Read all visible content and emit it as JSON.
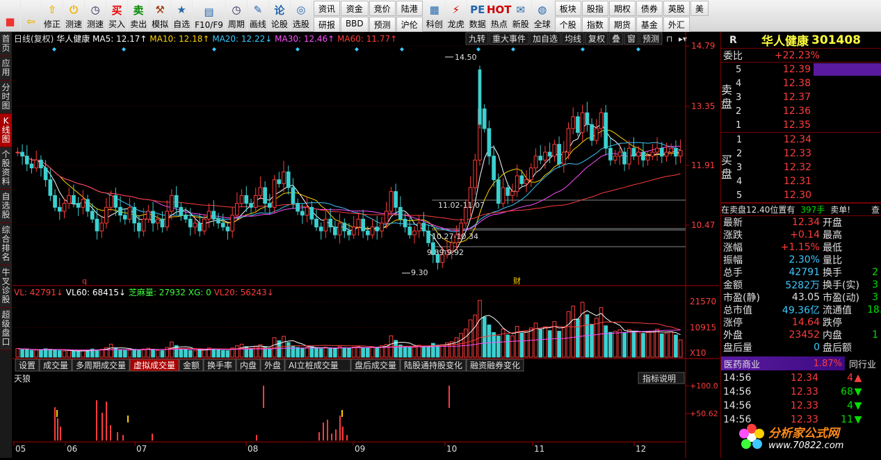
{
  "toolbar": {
    "buttons": [
      {
        "icon": "windows-icon",
        "label": ""
      },
      {
        "icon": "back-arrow-icon",
        "label": ""
      },
      {
        "icon": "up-arrow-icon",
        "label": "修正"
      },
      {
        "icon": "power-icon",
        "label": "测速"
      },
      {
        "icon": "clock-icon",
        "label": "测速"
      },
      {
        "icon": "buy-icon",
        "glyph": "买",
        "label": "买入"
      },
      {
        "icon": "sell-icon",
        "glyph": "卖",
        "label": "卖出"
      },
      {
        "icon": "hammer-icon",
        "label": "模拟"
      },
      {
        "icon": "star-icon",
        "label": "自选"
      },
      {
        "icon": "f10-icon",
        "label": "F10/F9"
      },
      {
        "icon": "clock-icon",
        "label": "周期"
      },
      {
        "icon": "pencil-icon",
        "label": "画线"
      },
      {
        "icon": "lun-icon",
        "glyph": "论",
        "label": "论股"
      },
      {
        "icon": "magnifier-icon",
        "label": "选股"
      }
    ],
    "grid_buttons": [
      "资讯",
      "研报",
      "资金",
      "BBD",
      "竞价",
      "预测",
      "陆港",
      "沪伦"
    ],
    "buttons2": [
      {
        "icon": "chart-icon",
        "label": "科创"
      },
      {
        "icon": "tiger-icon",
        "label": "龙虎"
      },
      {
        "icon": "pe-icon",
        "glyph": "PE",
        "label": "数据"
      },
      {
        "icon": "hot-icon",
        "glyph": "HOT",
        "label": "热点"
      },
      {
        "icon": "new-icon",
        "label": "新股"
      },
      {
        "icon": "globe-icon",
        "label": "全球"
      }
    ],
    "grid_buttons2": [
      "板块",
      "个股",
      "股指",
      "指数",
      "期权",
      "期货",
      "债券",
      "基金",
      "英股",
      "外汇",
      "美"
    ]
  },
  "leftbar": [
    "首页",
    "应用",
    "分时图",
    "K线图",
    "个股资料",
    "自选股",
    "综合排名",
    "牛叉诊股",
    "超级盘口"
  ],
  "header": {
    "title": "日线(复权)",
    "stock": "华人健康",
    "ma": [
      {
        "label": "MA5: 12.17↑",
        "color": "#ffffff"
      },
      {
        "label": "MA10: 12.18↑",
        "color": "#ffd200"
      },
      {
        "label": "MA20: 12.22↓",
        "color": "#3cc8ff"
      },
      {
        "label": "MA30: 12.46↑",
        "color": "#ff4fff"
      },
      {
        "label": "MA60: 11.77↑",
        "color": "#ff3c3c"
      }
    ],
    "buttons": [
      "九转",
      "重大事件",
      "加自选",
      "均线",
      "复权",
      "叠",
      "窗",
      "预测"
    ]
  },
  "price_axis": [
    "14.79",
    "13.35",
    "11.91",
    "10.47"
  ],
  "annotations": [
    "14.50",
    "11.02-11.07",
    "10.27-10.34",
    "9.89-9.92",
    "9.30"
  ],
  "markers": [
    "q",
    "财"
  ],
  "vol_header": {
    "items": [
      {
        "label": "VL: 42791↓",
        "color": "#ff3c3c"
      },
      {
        "label": "VL60: 68415↓",
        "color": "#ffffff"
      },
      {
        "label": "芝麻量: 27932",
        "color": "#3cff3c"
      },
      {
        "label": "XG: 0",
        "color": "#3cff3c"
      },
      {
        "label": "VL20: 56243↓",
        "color": "#ff3c3c"
      }
    ]
  },
  "vol_axis": [
    "21570",
    "10915",
    "X10"
  ],
  "tabs": [
    "设置",
    "成交量",
    "多周期成交量",
    "虚拟成交量",
    "金额",
    "换手率",
    "内盘",
    "外盘",
    "AI立桩成交量",
    "盘后成交量",
    "陆股通持股变化",
    "融资融券变化"
  ],
  "active_tab": "虚拟成交量",
  "ind_name": "天狼",
  "ind_button": "指标说明",
  "ind_axis": [
    "100.0",
    "50.62"
  ],
  "months": [
    "05",
    "06",
    "07",
    "08",
    "09",
    "10",
    "11",
    "12"
  ],
  "right": {
    "code_prefix": "R",
    "name": "华人健康",
    "code": "301408",
    "weibi_label": "委比",
    "weibi": "+22.23%",
    "sell_label": "卖盘",
    "buy_label": "买盘",
    "sell": [
      {
        "n": "5",
        "p": "12.39"
      },
      {
        "n": "4",
        "p": "12.38"
      },
      {
        "n": "3",
        "p": "12.37"
      },
      {
        "n": "2",
        "p": "12.36"
      },
      {
        "n": "1",
        "p": "12.35"
      }
    ],
    "buy": [
      {
        "n": "1",
        "p": "12.34"
      },
      {
        "n": "2",
        "p": "12.33"
      },
      {
        "n": "3",
        "p": "12.32"
      },
      {
        "n": "4",
        "p": "12.31"
      },
      {
        "n": "5",
        "p": "12.30"
      }
    ],
    "notice": "在卖盘12.40位置有",
    "notice_vol": "397手",
    "notice_tag": "卖单!",
    "notice_more": "查",
    "stats": [
      {
        "k": "最新",
        "v": "12.34",
        "vc": "red",
        "k2": "开盘",
        "v2": ""
      },
      {
        "k": "涨跌",
        "v": "+0.14",
        "vc": "red",
        "k2": "最高",
        "v2": ""
      },
      {
        "k": "涨幅",
        "v": "+1.15%",
        "vc": "red",
        "k2": "最低",
        "v2": ""
      },
      {
        "k": "振幅",
        "v": "2.30%",
        "vc": "cyn",
        "k2": "量比",
        "v2": ""
      },
      {
        "k": "总手",
        "v": "42791",
        "vc": "cyn",
        "k2": "换手",
        "v2": "2"
      },
      {
        "k": "金额",
        "v": "5282万",
        "vc": "cyn",
        "k2": "换手(实)",
        "v2": "3"
      },
      {
        "k": "市盈(静)",
        "v": "43.05",
        "vc": "wht",
        "k2": "市盈(动)",
        "v2": "3"
      },
      {
        "k": "总市值",
        "v": "49.36亿",
        "vc": "cyn",
        "k2": "流通值",
        "v2": "18."
      },
      {
        "k": "涨停",
        "v": "14.64",
        "vc": "red",
        "k2": "跌停",
        "v2": ""
      },
      {
        "k": "外盘",
        "v": "23452",
        "vc": "red",
        "k2": "内盘",
        "v2": "1"
      },
      {
        "k": "盘后量",
        "v": "0",
        "vc": "cyn",
        "k2": "盘后额",
        "v2": ""
      }
    ],
    "industry": "医药商业",
    "industry_pct": "1.87%",
    "industry_tab": "同行业",
    "ticks": [
      {
        "t": "14:56",
        "p": "12.34",
        "v": "4",
        "d": "up"
      },
      {
        "t": "14:56",
        "p": "12.33",
        "v": "68",
        "d": "down"
      },
      {
        "t": "14:56",
        "p": "12.33",
        "v": "4",
        "d": "down"
      },
      {
        "t": "14:56",
        "p": "12.33",
        "v": "11",
        "d": "down"
      }
    ],
    "watermark": "分析家公式网",
    "watermark_url": "www.70822.com"
  },
  "chart_data": {
    "type": "candlestick",
    "ylim": [
      9.0,
      15.0
    ],
    "closes": [
      12.3,
      12.2,
      12.0,
      11.9,
      12.1,
      11.9,
      11.6,
      11.2,
      10.9,
      10.8,
      11.0,
      11.2,
      11.0,
      10.9,
      11.1,
      10.8,
      10.6,
      10.3,
      10.5,
      10.9,
      11.2,
      10.9,
      10.7,
      10.6,
      10.9,
      10.5,
      10.3,
      10.6,
      10.8,
      10.5,
      10.6,
      10.4,
      10.8,
      11.2,
      10.9,
      10.7,
      10.6,
      10.4,
      10.5,
      10.3,
      10.6,
      10.8,
      10.6,
      10.5,
      10.4,
      10.3,
      10.7,
      11.0,
      11.2,
      11.0,
      10.9,
      11.2,
      11.4,
      11.0,
      10.9,
      11.6,
      11.5,
      11.8,
      11.4,
      11.0,
      10.8,
      10.7,
      10.9,
      10.6,
      10.4,
      10.3,
      10.6,
      10.4,
      10.2,
      10.5,
      10.3,
      10.2,
      10.4,
      10.6,
      10.3,
      10.2,
      10.4,
      10.3,
      10.5,
      10.8,
      11.3,
      10.9,
      10.6,
      10.4,
      10.2,
      10.3,
      10.5,
      10.3,
      10.0,
      9.7,
      9.5,
      9.7,
      9.8,
      10.0,
      10.2,
      10.5,
      10.9,
      11.4,
      12.1,
      13.4,
      12.9,
      12.2,
      11.6,
      11.0,
      11.4,
      11.2,
      11.3,
      11.7,
      11.5,
      11.6,
      11.9,
      12.2,
      12.1,
      12.3,
      12.2,
      12.5,
      12.0,
      12.3,
      12.9,
      13.2,
      12.8,
      13.3,
      13.0,
      12.6,
      12.9,
      13.3,
      12.4,
      12.1,
      12.2,
      12.3,
      12.0,
      12.4,
      12.2,
      12.3,
      12.1,
      12.2,
      12.3,
      12.4,
      12.2,
      12.3,
      12.4,
      12.2,
      12.34
    ],
    "volumes": [
      3200,
      2800,
      3000,
      2500,
      2600,
      2700,
      3100,
      2900,
      2600,
      2400,
      2300,
      2500,
      2200,
      2100,
      2400,
      2600,
      3000,
      2700,
      2900,
      3500,
      4800,
      3300,
      2700,
      2500,
      2600,
      2900,
      2800,
      3000,
      3300,
      2700,
      2500,
      2400,
      3600,
      5600,
      4300,
      3100,
      2700,
      2500,
      2400,
      2600,
      2900,
      3400,
      3100,
      2800,
      2500,
      2400,
      3400,
      4200,
      4800,
      3900,
      3300,
      4000,
      4600,
      3800,
      3300,
      7200,
      6100,
      7700,
      5400,
      4200,
      3600,
      3400,
      3700,
      3900,
      3300,
      3100,
      3600,
      3300,
      3100,
      3900,
      3500,
      3200,
      3700,
      4000,
      3600,
      3400,
      3900,
      3600,
      4200,
      4700,
      7900,
      6200,
      4500,
      3900,
      3600,
      3700,
      4400,
      4100,
      3900,
      5100,
      4400,
      4600,
      5300,
      5700,
      7200,
      8800,
      10400,
      13800,
      15600,
      21000,
      14800,
      11900,
      9100,
      7800,
      10400,
      8200,
      7900,
      11400,
      8900,
      9400,
      10800,
      12600,
      10100,
      11200,
      9800,
      13200,
      9600,
      10900,
      16800,
      18900,
      14100,
      20300,
      15700,
      12200,
      14400,
      18300,
      11600,
      9200,
      9600,
      10100,
      8900,
      10200,
      9400,
      9300,
      8800,
      9100,
      9600,
      10300,
      8600,
      8900,
      9400,
      8200,
      6400
    ]
  }
}
